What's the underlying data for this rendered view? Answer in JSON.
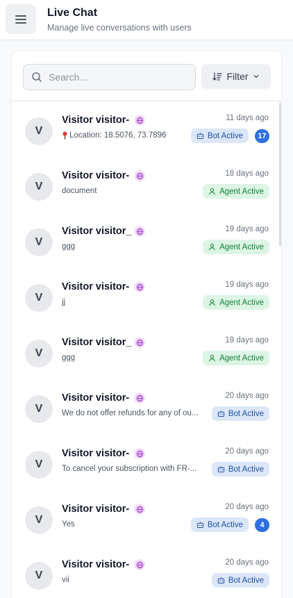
{
  "header": {
    "title": "Live Chat",
    "subtitle": "Manage live conversations with users",
    "menu_icon": "menu-icon"
  },
  "toolbar": {
    "search_placeholder": "Search...",
    "search_value": "",
    "filter_label": "Filter"
  },
  "colors": {
    "bot_badge_bg": "#dbe7f8",
    "bot_badge_text": "#1f4fa3",
    "agent_badge_bg": "#dcf5e4",
    "agent_badge_text": "#15803d",
    "unread_badge": "#2f6fe0",
    "globe_badge_bg": "#f3e1f7"
  },
  "conversations": [
    {
      "avatar": "V",
      "name": "Visitor visitor-",
      "preview": "Location: 18.5076, 73.7896",
      "preview_icon": "location-pin-icon",
      "time": "11 days ago",
      "status": "Bot Active",
      "status_type": "bot",
      "unread": "17"
    },
    {
      "avatar": "V",
      "name": "Visitor visitor-",
      "preview": "document",
      "preview_icon": "",
      "time": "18 days ago",
      "status": "Agent Active",
      "status_type": "agent",
      "unread": ""
    },
    {
      "avatar": "V",
      "name": "Visitor visitor_",
      "preview": "ggg",
      "preview_icon": "",
      "time": "19 days ago",
      "status": "Agent Active",
      "status_type": "agent",
      "unread": ""
    },
    {
      "avatar": "V",
      "name": "Visitor visitor-",
      "preview": "jj",
      "preview_icon": "",
      "time": "19 days ago",
      "status": "Agent Active",
      "status_type": "agent",
      "unread": ""
    },
    {
      "avatar": "V",
      "name": "Visitor visitor_",
      "preview": "ggg",
      "preview_icon": "",
      "time": "19 days ago",
      "status": "Agent Active",
      "status_type": "agent",
      "unread": ""
    },
    {
      "avatar": "V",
      "name": "Visitor visitor-",
      "preview": "We do not offer refunds for any of ou...",
      "preview_icon": "",
      "time": "20 days ago",
      "status": "Bot Active",
      "status_type": "bot",
      "unread": ""
    },
    {
      "avatar": "V",
      "name": "Visitor visitor-",
      "preview": "To cancel your subscription with FR-...",
      "preview_icon": "",
      "time": "20 days ago",
      "status": "Bot Active",
      "status_type": "bot",
      "unread": ""
    },
    {
      "avatar": "V",
      "name": "Visitor visitor-",
      "preview": "Yes",
      "preview_icon": "",
      "time": "20 days ago",
      "status": "Bot Active",
      "status_type": "bot",
      "unread": "4"
    },
    {
      "avatar": "V",
      "name": "Visitor visitor-",
      "preview": "vii",
      "preview_icon": "",
      "time": "20 days ago",
      "status": "Bot Active",
      "status_type": "bot",
      "unread": ""
    }
  ]
}
